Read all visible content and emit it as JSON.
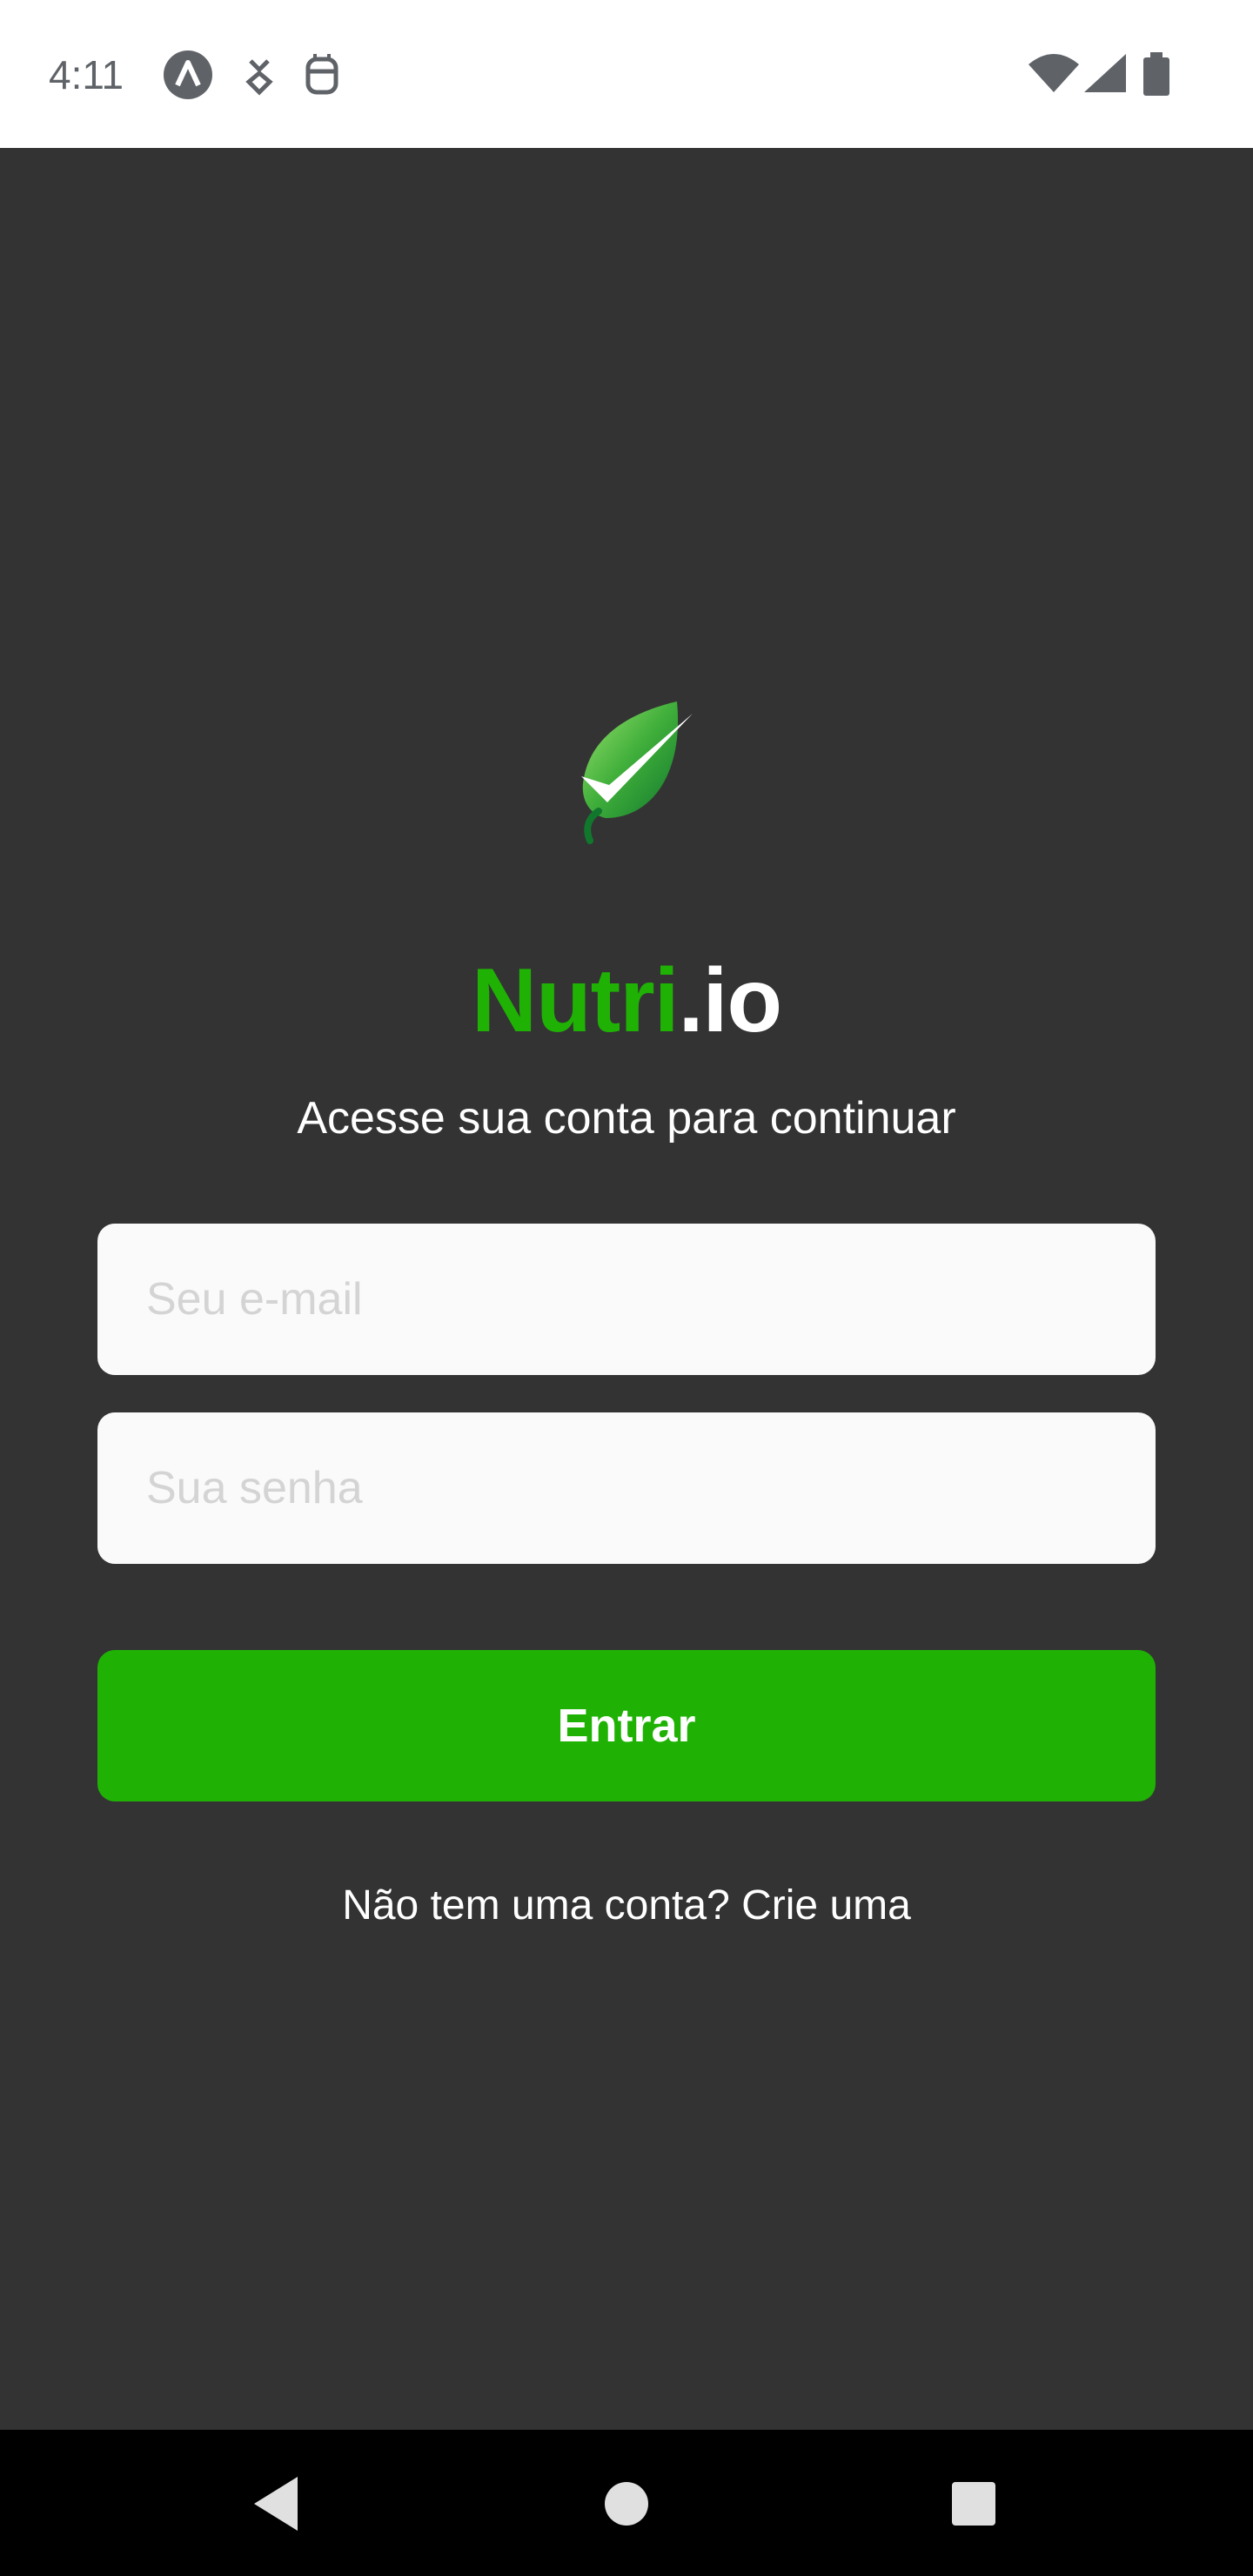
{
  "status_bar": {
    "time": "4:11",
    "icons": [
      "app-notification-icon",
      "download-icon",
      "robot-icon",
      "wifi-icon",
      "signal-icon",
      "battery-icon"
    ]
  },
  "brand": {
    "name_part1": "Nutri",
    "name_part2": ".io",
    "accent_color": "#1fb205",
    "logo_icon": "leaf-check-icon"
  },
  "login": {
    "subtitle": "Acesse sua conta para continuar",
    "email_placeholder": "Seu e-mail",
    "password_placeholder": "Sua senha",
    "submit_label": "Entrar",
    "signup_text": "Não tem uma conta? Crie uma"
  },
  "nav_bar": {
    "buttons": [
      "back-icon",
      "home-icon",
      "recents-icon"
    ]
  }
}
